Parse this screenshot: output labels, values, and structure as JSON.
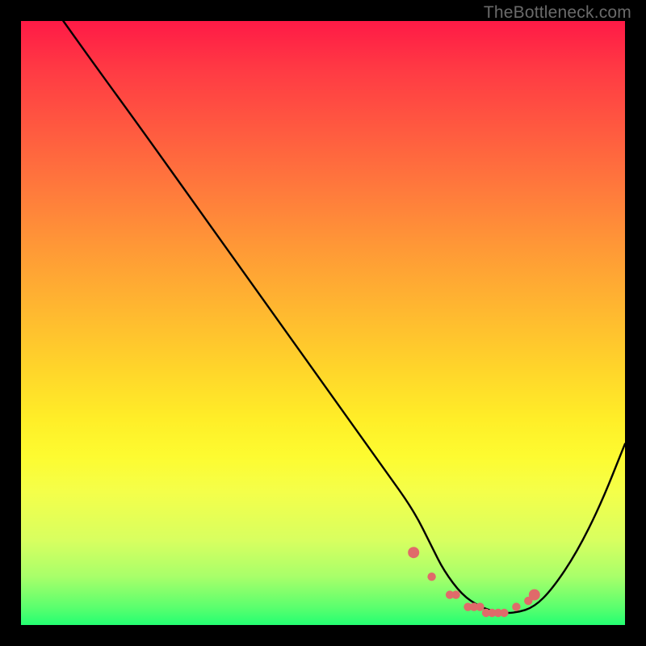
{
  "watermark": {
    "text": "TheBottleneck.com"
  },
  "chart_data": {
    "type": "line",
    "title": "",
    "xlabel": "",
    "ylabel": "",
    "xlim": [
      0,
      100
    ],
    "ylim": [
      0,
      100
    ],
    "series": [
      {
        "name": "curve",
        "x": [
          7,
          12,
          20,
          30,
          40,
          50,
          60,
          65,
          68,
          70,
          73,
          76,
          79,
          82,
          85,
          88,
          92,
          96,
          100
        ],
        "y": [
          100,
          93,
          82,
          68,
          54,
          40,
          26,
          19,
          13,
          9,
          5,
          3,
          2,
          2,
          3,
          6,
          12,
          20,
          30
        ]
      }
    ],
    "dots": {
      "name": "valley-dots",
      "x": [
        65,
        68,
        71,
        72,
        74,
        75,
        76,
        77,
        78,
        79,
        80,
        82,
        84,
        85
      ],
      "y": [
        12,
        8,
        5,
        5,
        3,
        3,
        3,
        2,
        2,
        2,
        2,
        3,
        4,
        5
      ]
    },
    "colors": {
      "curve": "#000000",
      "dots": "#e06a6a"
    }
  }
}
